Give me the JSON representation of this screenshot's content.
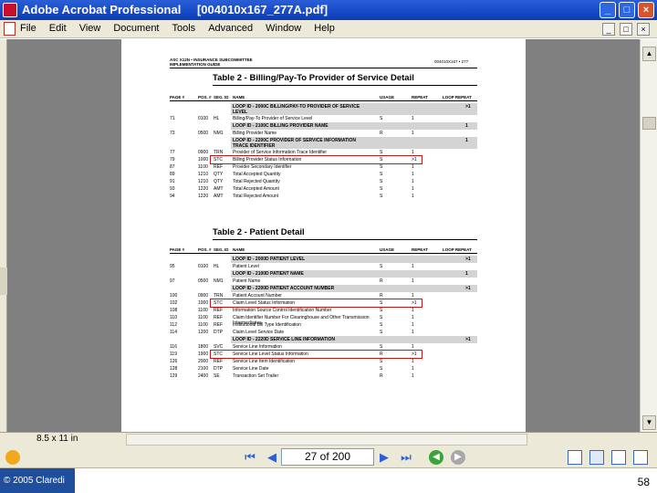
{
  "window": {
    "app_title": "Adobe Acrobat Professional",
    "doc_title": "[004010x167_277A.pdf]"
  },
  "menu": [
    "File",
    "Edit",
    "View",
    "Document",
    "Tools",
    "Advanced",
    "Window",
    "Help"
  ],
  "status": {
    "page_size": "8.5 x 11 in"
  },
  "nav": {
    "page_display": "27 of 200"
  },
  "footer": {
    "copyright": "© 2005 Claredi",
    "slide_number": "58"
  },
  "doc": {
    "header_left_1": "ASC X12N • INSURANCE SUBCOMMITTEE",
    "header_left_2": "IMPLEMENTATION GUIDE",
    "header_right": "004010X167 • 277",
    "table1_title": "Table 2 - Billing/Pay-To Provider of Service Detail",
    "table2_title": "Table 2 - Patient Detail",
    "col_headers": [
      "PAGE #",
      "POS. #",
      "SEG. ID",
      "NAME",
      "USAGE",
      "REPEAT",
      "LOOP REPEAT"
    ],
    "table1_rows": [
      {
        "page": "",
        "pos": "",
        "seg": "",
        "name": "LOOP ID - 2000C BILLING/PAY-TO PROVIDER OF SERVICE LEVEL",
        "usage": "",
        "repeat": "",
        "loop": ">1",
        "loop_header": true
      },
      {
        "page": "71",
        "pos": "0100",
        "seg": "HL",
        "name": "Billing/Pay-To Provider of Service Level",
        "usage": "S",
        "repeat": "1",
        "loop": ""
      },
      {
        "page": "",
        "pos": "",
        "seg": "",
        "name": "LOOP ID - 2100C BILLING PROVIDER NAME",
        "usage": "",
        "repeat": "",
        "loop": "1",
        "loop_header": true
      },
      {
        "page": "73",
        "pos": "0500",
        "seg": "NM1",
        "name": "Billing Provider Name",
        "usage": "R",
        "repeat": "1",
        "loop": ""
      },
      {
        "page": "",
        "pos": "",
        "seg": "",
        "name": "LOOP ID - 2200C PROVIDER OF SERVICE INFORMATION TRACE IDENTIFIER",
        "usage": "",
        "repeat": "",
        "loop": "1",
        "loop_header": true
      },
      {
        "page": "77",
        "pos": "0900",
        "seg": "TRN",
        "name": "Provider of Service Information Trace Identifier",
        "usage": "S",
        "repeat": "1",
        "loop": ""
      },
      {
        "page": "79",
        "pos": "1000",
        "seg": "STC",
        "name": "Billing Provider Status Information",
        "usage": "S",
        "repeat": ">1",
        "loop": ""
      },
      {
        "page": "87",
        "pos": "1100",
        "seg": "REF",
        "name": "Provider Secondary Identifier",
        "usage": "S",
        "repeat": "1",
        "loop": ""
      },
      {
        "page": "89",
        "pos": "1210",
        "seg": "QTY",
        "name": "Total Accepted Quantity",
        "usage": "S",
        "repeat": "1",
        "loop": ""
      },
      {
        "page": "91",
        "pos": "1210",
        "seg": "QTY",
        "name": "Total Rejected Quantity",
        "usage": "S",
        "repeat": "1",
        "loop": ""
      },
      {
        "page": "93",
        "pos": "1220",
        "seg": "AMT",
        "name": "Total Accepted Amount",
        "usage": "S",
        "repeat": "1",
        "loop": ""
      },
      {
        "page": "94",
        "pos": "1220",
        "seg": "AMT",
        "name": "Total Rejected Amount",
        "usage": "S",
        "repeat": "1",
        "loop": ""
      }
    ],
    "table2_rows": [
      {
        "page": "",
        "pos": "",
        "seg": "",
        "name": "LOOP ID - 2000D PATIENT LEVEL",
        "usage": "",
        "repeat": "",
        "loop": ">1",
        "loop_header": true
      },
      {
        "page": "95",
        "pos": "0100",
        "seg": "HL",
        "name": "Patient Level",
        "usage": "S",
        "repeat": "1",
        "loop": ""
      },
      {
        "page": "",
        "pos": "",
        "seg": "",
        "name": "LOOP ID - 2100D PATIENT NAME",
        "usage": "",
        "repeat": "",
        "loop": "1",
        "loop_header": true
      },
      {
        "page": "97",
        "pos": "0500",
        "seg": "NM1",
        "name": "Patient Name",
        "usage": "R",
        "repeat": "1",
        "loop": ""
      },
      {
        "page": "",
        "pos": "",
        "seg": "",
        "name": "LOOP ID - 2200D PATIENT ACCOUNT NUMBER",
        "usage": "",
        "repeat": "",
        "loop": ">1",
        "loop_header": true
      },
      {
        "page": "100",
        "pos": "0900",
        "seg": "TRN",
        "name": "Patient Account Number",
        "usage": "R",
        "repeat": "1",
        "loop": ""
      },
      {
        "page": "102",
        "pos": "1000",
        "seg": "STC",
        "name": "Claim Level Status Information",
        "usage": "S",
        "repeat": ">1",
        "loop": ""
      },
      {
        "page": "108",
        "pos": "1100",
        "seg": "REF",
        "name": "Information Source Control Identification Number",
        "usage": "S",
        "repeat": "1",
        "loop": ""
      },
      {
        "page": "110",
        "pos": "1100",
        "seg": "REF",
        "name": "Claim Identifier Number For Clearinghouse and Other Transmission Intermediaries",
        "usage": "S",
        "repeat": "1",
        "loop": ""
      },
      {
        "page": "112",
        "pos": "1100",
        "seg": "REF",
        "name": "Institutional Bill Type Identification",
        "usage": "S",
        "repeat": "1",
        "loop": ""
      },
      {
        "page": "114",
        "pos": "1200",
        "seg": "DTP",
        "name": "Claim Level Service Date",
        "usage": "S",
        "repeat": "1",
        "loop": ""
      },
      {
        "page": "",
        "pos": "",
        "seg": "",
        "name": "LOOP ID - 2220D SERVICE LINE INFORMATION",
        "usage": "",
        "repeat": "",
        "loop": ">1",
        "loop_header": true
      },
      {
        "page": "116",
        "pos": "1800",
        "seg": "SVC",
        "name": "Service Line Information",
        "usage": "S",
        "repeat": "1",
        "loop": ""
      },
      {
        "page": "119",
        "pos": "1900",
        "seg": "STC",
        "name": "Service Line Level Status Information",
        "usage": "R",
        "repeat": ">1",
        "loop": ""
      },
      {
        "page": "126",
        "pos": "2000",
        "seg": "REF",
        "name": "Service Line Item Identification",
        "usage": "S",
        "repeat": "1",
        "loop": ""
      },
      {
        "page": "128",
        "pos": "2100",
        "seg": "DTP",
        "name": "Service Line Date",
        "usage": "S",
        "repeat": "1",
        "loop": ""
      },
      {
        "page": "129",
        "pos": "2400",
        "seg": "SE",
        "name": "Transaction Set Trailer",
        "usage": "R",
        "repeat": "1",
        "loop": ""
      }
    ]
  },
  "colors": {
    "title_bar": "#0a3cb8",
    "highlight": "#c01818",
    "footer_brand": "#1f4f9c"
  }
}
